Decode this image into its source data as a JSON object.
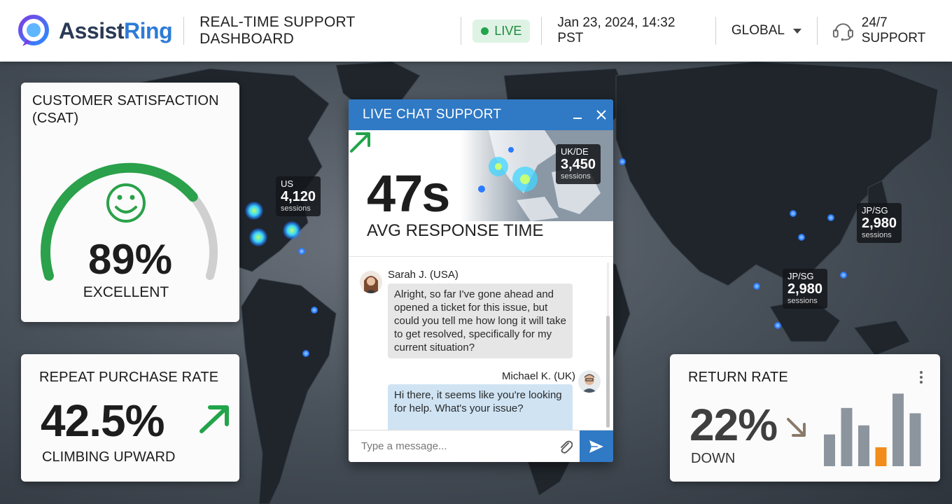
{
  "header": {
    "brand_part1": "Assist",
    "brand_part2": "Ring",
    "title": "REAL-TIME SUPPORT DASHBOARD",
    "live_label": "LIVE",
    "datetime": "Jan 23, 2024, 14:32 PST",
    "region_selected": "GLOBAL",
    "support_label": "24/7 SUPPORT"
  },
  "colors": {
    "accent_blue": "#2f79c5",
    "positive_green": "#22a44a",
    "alert_orange": "#f28c1a"
  },
  "map_labels": [
    {
      "code": "US",
      "value": "4,120",
      "unit": "sessions"
    },
    {
      "code": "JP/SG",
      "value": "2,980",
      "unit": "sessions"
    },
    {
      "code": "JP/SG",
      "value": "2,980",
      "unit": "sessions"
    }
  ],
  "csat": {
    "title": "CUSTOMER SATISFACTION (CSAT)",
    "value": "89%",
    "gauge_fraction": 0.89,
    "rating": "EXCELLENT",
    "icon": "smiley-face-icon"
  },
  "repeat_purchase": {
    "title": "REPEAT PURCHASE RATE",
    "value": "42.5%",
    "trend": "CLIMBING UPWARD",
    "trend_icon": "arrow-up-right-icon"
  },
  "return_rate": {
    "title": "RETURN RATE",
    "value": "22%",
    "trend": "DOWN",
    "trend_icon": "arrow-down-right-icon",
    "menu_icon": "kebab-menu-icon",
    "bar_levels": [
      0.42,
      0.77,
      0.54,
      0.25,
      0.96,
      0.7
    ],
    "highlight_index": 3
  },
  "chat": {
    "title": "LIVE CHAT SUPPORT",
    "minimize_icon": "minimize-icon",
    "close_icon": "close-icon",
    "avg_response_value": "47s",
    "avg_response_label": "AVG RESPONSE TIME",
    "hero_region": {
      "code": "UK/DE",
      "value": "3,450",
      "unit": "sessions"
    },
    "messages": [
      {
        "author": "Sarah J. (USA)",
        "text": "Alright, so far I've gone ahead and opened a ticket for this issue, but could you tell me how long it will take to get resolved, specifically for my current situation?"
      },
      {
        "author": "Michael K. (UK)",
        "text": "Hi there, it seems like you're looking for help. What's your issue?"
      }
    ],
    "input_placeholder": "Type a message...",
    "attach_icon": "paperclip-icon",
    "send_icon": "send-icon"
  }
}
